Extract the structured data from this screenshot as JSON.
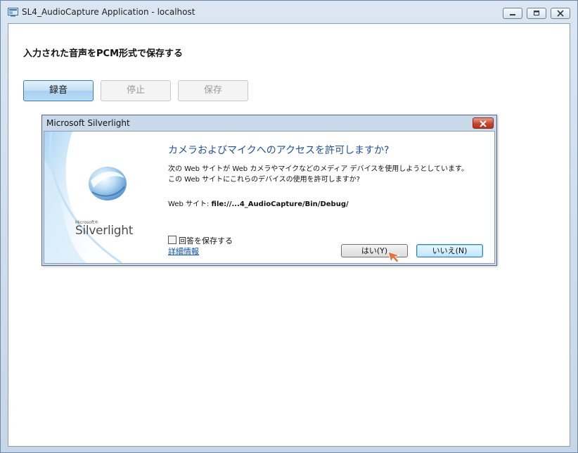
{
  "window": {
    "title": "SL4_AudioCapture Application - localhost",
    "icons": {
      "app": "silverlight-app-icon",
      "minimize": "minimize-icon",
      "maximize": "maximize-icon",
      "close": "close-icon"
    }
  },
  "app": {
    "heading": "入力された音声をPCM形式で保存する",
    "buttons": {
      "record": "録音",
      "stop": "停止",
      "save": "保存"
    }
  },
  "dialog": {
    "title": "Microsoft Silverlight",
    "brand_small": "Microsoft®",
    "brand": "Silverlight",
    "question": "カメラおよびマイクへのアクセスを許可しますか?",
    "description": "次の Web サイトが Web カメラやマイクなどのメディア デバイスを使用しようとしています。この Web サイトにこれらのデバイスの使用を許可しますか?",
    "site_label": "Web サイト: ",
    "site_url": "file://...4_AudioCapture/Bin/Debug/",
    "remember_label": "回答を保存する",
    "remember_checked": false,
    "more_info": "詳細情報",
    "yes_button": "はい(Y)",
    "no_button": "いいえ(N)"
  }
}
